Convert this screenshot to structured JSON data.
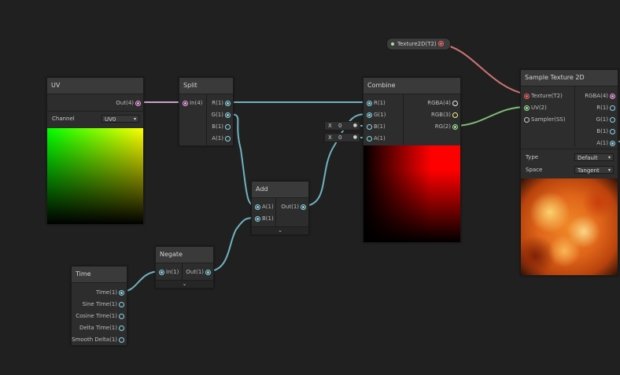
{
  "colors": {
    "wire_vector": "#69b4c4",
    "wire_uv": "#caa3c8",
    "wire_texture": "#d27575",
    "wire_green": "#80c078",
    "port_vector4": "#f2a0e8",
    "port_vector1": "#8cd7e5",
    "port_vector2": "#9fe69a",
    "port_vector3": "#f6f38e",
    "port_texture": "#f46262",
    "port_sampler": "#c8c8c8"
  },
  "property": {
    "label": "Texture2D(T2)"
  },
  "nodes": {
    "uv": {
      "title": "UV",
      "output": "Out(4)",
      "channel_label": "Channel",
      "channel_value": "UV0"
    },
    "split": {
      "title": "Split",
      "input": "In(4)",
      "outputs": [
        "R(1)",
        "G(1)",
        "B(1)",
        "A(1)"
      ]
    },
    "combine": {
      "title": "Combine",
      "inputs": [
        "R(1)",
        "G(1)",
        "B(1)",
        "A(1)"
      ],
      "outputs": [
        "RGBA(4)",
        "RGB(3)",
        "RG(2)"
      ],
      "inline_b": {
        "axis": "X",
        "value": "0"
      },
      "inline_a": {
        "axis": "X",
        "value": "0"
      }
    },
    "add": {
      "title": "Add",
      "inputs": [
        "A(1)",
        "B(1)"
      ],
      "output": "Out(1)",
      "expand": "⌄"
    },
    "negate": {
      "title": "Negate",
      "input": "In(1)",
      "output": "Out(1)",
      "expand": "⌄"
    },
    "time": {
      "title": "Time",
      "outputs": [
        "Time(1)",
        "Sine Time(1)",
        "Cosine Time(1)",
        "Delta Time(1)",
        "Smooth Delta(1)"
      ]
    },
    "sample": {
      "title": "Sample Texture 2D",
      "inputs": [
        "Texture(T2)",
        "UV(2)",
        "Sampler(SS)"
      ],
      "outputs": [
        "RGBA(4)",
        "R(1)",
        "G(1)",
        "B(1)",
        "A(1)"
      ],
      "type_label": "Type",
      "type_value": "Default",
      "space_label": "Space",
      "space_value": "Tangent"
    }
  }
}
